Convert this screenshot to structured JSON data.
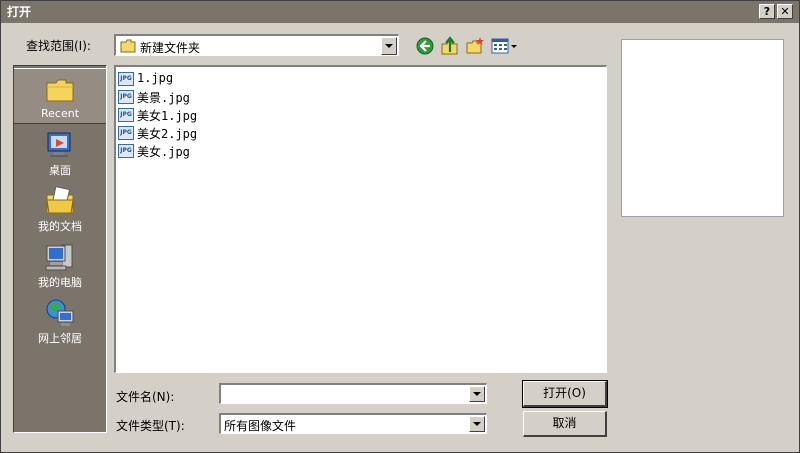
{
  "window": {
    "title": "打开",
    "help_label": "?",
    "close_label": "✕"
  },
  "lookin": {
    "label": "查找范围(I):",
    "value": "新建文件夹"
  },
  "toolbar": {
    "back_icon": "back-icon",
    "up_icon": "up-folder-icon",
    "new_folder_icon": "new-folder-icon",
    "view_icon": "view-menu-icon"
  },
  "places": [
    {
      "label": "Recent",
      "icon": "recent-folder-icon"
    },
    {
      "label": "桌面",
      "icon": "desktop-icon"
    },
    {
      "label": "我的文档",
      "icon": "my-documents-icon"
    },
    {
      "label": "我的电脑",
      "icon": "my-computer-icon"
    },
    {
      "label": "网上邻居",
      "icon": "network-icon"
    }
  ],
  "files": [
    {
      "name": "1.jpg"
    },
    {
      "name": "美景.jpg"
    },
    {
      "name": "美女1.jpg"
    },
    {
      "name": "美女2.jpg"
    },
    {
      "name": "美女.jpg"
    }
  ],
  "file_icon_text": "JPG",
  "filename": {
    "label": "文件名(N):",
    "value": ""
  },
  "filetype": {
    "label": "文件类型(T):",
    "value": "所有图像文件"
  },
  "buttons": {
    "open": "打开(O)",
    "cancel": "取消"
  },
  "colors": {
    "titlebar": "#7b746b",
    "places_bar": "#7b746b",
    "face": "#d4d0c8"
  }
}
